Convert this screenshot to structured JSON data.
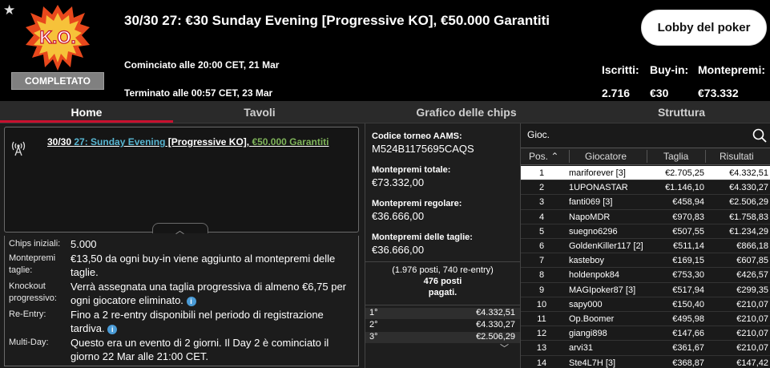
{
  "header": {
    "title": "30/30 27: €30 Sunday Evening [Progressive KO], €50.000 Garantiti",
    "started": "Cominciato alle 20:00 CET, 21 Mar",
    "ended": "Terminato alle 00:57 CET, 23 Mar",
    "logo_text": "K.O.",
    "status_badge": "COMPLETATO",
    "lobby_button": "Lobby del poker",
    "stats": [
      {
        "label": "Iscritti:",
        "value": "2.716"
      },
      {
        "label": "Buy-in:",
        "value": "€30"
      },
      {
        "label": "Montepremi:",
        "value": "€73.332"
      }
    ]
  },
  "tabs": [
    {
      "label": "Home",
      "active": true
    },
    {
      "label": "Tavoli",
      "active": false
    },
    {
      "label": "Grafico delle chips",
      "active": false
    },
    {
      "label": "Struttura",
      "active": false
    }
  ],
  "tournament_name": {
    "part1": "30/30 ",
    "part2": "27: Sunday Evening",
    "part3": " [Progressive KO], ",
    "part4": "€50.000 Garantiti"
  },
  "info": [
    {
      "label": "Chips iniziali:",
      "value": "5.000",
      "info_icon": false
    },
    {
      "label": "Montepremi taglie:",
      "value": "€13,50 da ogni buy-in viene aggiunto al montepremi delle taglie.",
      "info_icon": false
    },
    {
      "label": "Knockout progressivo:",
      "value": "Verrà assegnata una taglia progressiva di almeno €6,75 per ogni giocatore eliminato.",
      "info_icon": true
    },
    {
      "label": "Re-Entry:",
      "value": "Fino a 2 re-entry disponibili nel periodo di registrazione tardiva.",
      "info_icon": true
    },
    {
      "label": "Multi-Day:",
      "value": "Questo era un evento di 2 giorni. Il Day 2 è cominciato il giorno 22 Mar alle 21:00 CET.",
      "info_icon": false
    }
  ],
  "prize_info": {
    "aams_label": "Codice torneo AAMS:",
    "aams_code": "M524B1175695CAQS",
    "total_label": "Montepremi totale:",
    "total_value": "€73.332,00",
    "regular_label": "Montepremi regolare:",
    "regular_value": "€36.666,00",
    "bounty_label": "Montepremi delle taglie:",
    "bounty_value": "€36.666,00",
    "entries_note": "(1.976 posti, 740 re-entry)",
    "paid_line1": "476 posti",
    "paid_line2": "pagati."
  },
  "payouts": [
    {
      "pos": "1°",
      "amount": "€4.332,51"
    },
    {
      "pos": "2°",
      "amount": "€4.330,27"
    },
    {
      "pos": "3°",
      "amount": "€2.506,29"
    }
  ],
  "players": {
    "search_label": "Gioc.",
    "columns": [
      "Pos.",
      "Giocatore",
      "Taglia",
      "Risultati"
    ],
    "rows": [
      {
        "pos": "1",
        "name": "mariforever [3]",
        "bounty": "€2.705,25",
        "result": "€4.332,51"
      },
      {
        "pos": "2",
        "name": "1UPONASTAR",
        "bounty": "€1.146,10",
        "result": "€4.330,27"
      },
      {
        "pos": "3",
        "name": "fanti069 [3]",
        "bounty": "€458,94",
        "result": "€2.506,29"
      },
      {
        "pos": "4",
        "name": "NapoMDR",
        "bounty": "€970,83",
        "result": "€1.758,83"
      },
      {
        "pos": "5",
        "name": "suegno6296",
        "bounty": "€507,55",
        "result": "€1.234,29"
      },
      {
        "pos": "6",
        "name": "GoldenKiller117 [2]",
        "bounty": "€511,14",
        "result": "€866,18"
      },
      {
        "pos": "7",
        "name": "kasteboy",
        "bounty": "€169,15",
        "result": "€607,85"
      },
      {
        "pos": "8",
        "name": "holdenpok84",
        "bounty": "€753,30",
        "result": "€426,57"
      },
      {
        "pos": "9",
        "name": "MAGIpoker87 [3]",
        "bounty": "€517,94",
        "result": "€299,35"
      },
      {
        "pos": "10",
        "name": "sapy000",
        "bounty": "€150,40",
        "result": "€210,07"
      },
      {
        "pos": "11",
        "name": "Op.Boomer",
        "bounty": "€495,98",
        "result": "€210,07"
      },
      {
        "pos": "12",
        "name": "giangi898",
        "bounty": "€147,66",
        "result": "€210,07"
      },
      {
        "pos": "13",
        "name": "arvi31",
        "bounty": "€361,67",
        "result": "€210,07"
      },
      {
        "pos": "14",
        "name": "Ste4L7H [3]",
        "bounty": "€368,87",
        "result": "€147,42"
      }
    ]
  },
  "colors": {
    "accent_red": "#c8102e",
    "link_blue": "#58b6d2",
    "guarantee_green": "#7fb45a"
  }
}
